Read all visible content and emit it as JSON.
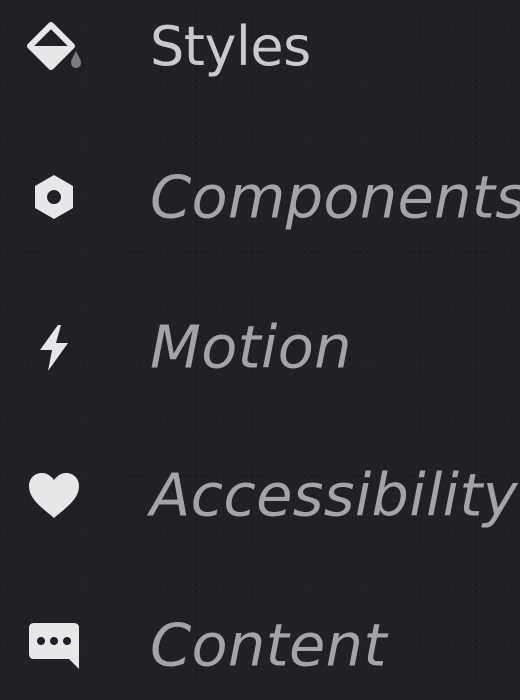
{
  "nav": {
    "items": [
      {
        "id": "styles",
        "label": "Styles",
        "icon": "paint-bucket-icon",
        "active": true
      },
      {
        "id": "components",
        "label": "Components",
        "icon": "hexagon-icon",
        "active": false
      },
      {
        "id": "motion",
        "label": "Motion",
        "icon": "lightning-bolt-icon",
        "active": false
      },
      {
        "id": "accessibility",
        "label": "Accessibility",
        "icon": "heart-icon",
        "active": false
      },
      {
        "id": "content",
        "label": "Content",
        "icon": "chat-bubble-icon",
        "active": false
      }
    ]
  },
  "colors": {
    "background": "#1f2124",
    "icon": "#e6e7e9",
    "active_label": "#c9cacc",
    "idle_label": "#a3a4a6",
    "drip": "#7a7c80"
  }
}
